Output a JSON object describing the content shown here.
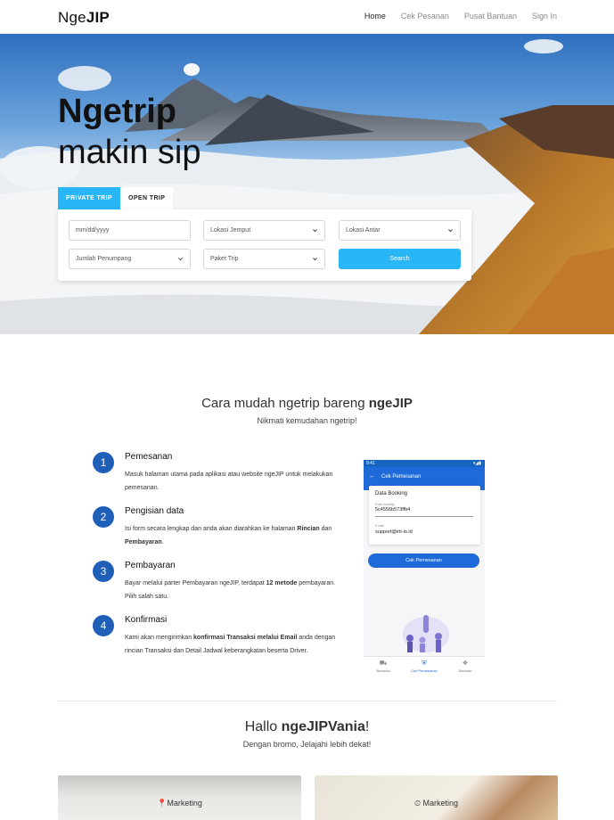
{
  "brand": {
    "prefix": "Nge",
    "bold": "JIP"
  },
  "nav": {
    "home": "Home",
    "cek": "Cek Pesanan",
    "bantuan": "Pusat Bantuan",
    "signin": "Sign In"
  },
  "hero": {
    "line1": "Ngetrip",
    "line2": "makin sip"
  },
  "tabs": {
    "private": "PRIVATE TRIP",
    "open": "OPEN TRIP"
  },
  "form": {
    "date_placeholder": "mm/dd/yyyy",
    "jemput": "Lokasi Jemput",
    "antar": "Lokasi Antar",
    "penumpang": "Jumlah Penumpang",
    "paket": "Paket Trip",
    "search": "Search"
  },
  "how": {
    "title_pre": "Cara mudah ngetrip bareng ",
    "title_bold": "ngeJIP",
    "subtitle": "Nikmati kemudahan ngetrip!"
  },
  "steps": [
    {
      "num": "1",
      "title": "Pemesanan",
      "desc": "Masuk halaman utama pada aplikasi atau website ngeJIP untuk melakukan pemesanan."
    },
    {
      "num": "2",
      "title": "Pengisian data",
      "desc_a": "Isi form secara lengkap dan anda akan diarahkan ke halaman ",
      "desc_b": "Rincian",
      "desc_c": " dan ",
      "desc_d": "Pembayaran",
      "desc_e": "."
    },
    {
      "num": "3",
      "title": "Pembayaran",
      "desc_a": "Bayar melalui parter Pembayaran ngeJIP, terdapat ",
      "desc_b": "12 metode",
      "desc_c": " pembayaran. Pilih salah satu."
    },
    {
      "num": "4",
      "title": "Konfirmasi",
      "desc_a": "Kami akan mengirimkan ",
      "desc_b": "konfirmasi Transaksi melalui Email",
      "desc_c": " anda dengan rincian Transaksi dan Detail Jadwal keberangkatan beserta Driver."
    }
  ],
  "phone": {
    "time": "9:41",
    "bar_title": "Cek Pemesanan",
    "card_title": "Data Booking",
    "kode_label": "Kode booking",
    "kode_value": "5c4556b573ffb4",
    "email_label": "E-mail",
    "email_value": "support@irit-io.id",
    "button": "Cek Pemesanan",
    "nav_beranda": "Beranda",
    "nav_cek": "Cek Pemesanan",
    "nav_bantuan": "Bantuan"
  },
  "hallo": {
    "pre": "Hallo ",
    "bold": "ngeJIPVania",
    "post": "!",
    "subtitle": "Dengan bromo, Jelajahi lebih dekat!"
  },
  "cards": [
    {
      "tag": "Marketing",
      "icon": "pin-icon"
    },
    {
      "tag": "Marketing",
      "icon": "clock-icon"
    }
  ],
  "colors": {
    "accent": "#29b6f6",
    "step_blue": "#1f5fb8",
    "phone_blue": "#1e6ad8"
  }
}
